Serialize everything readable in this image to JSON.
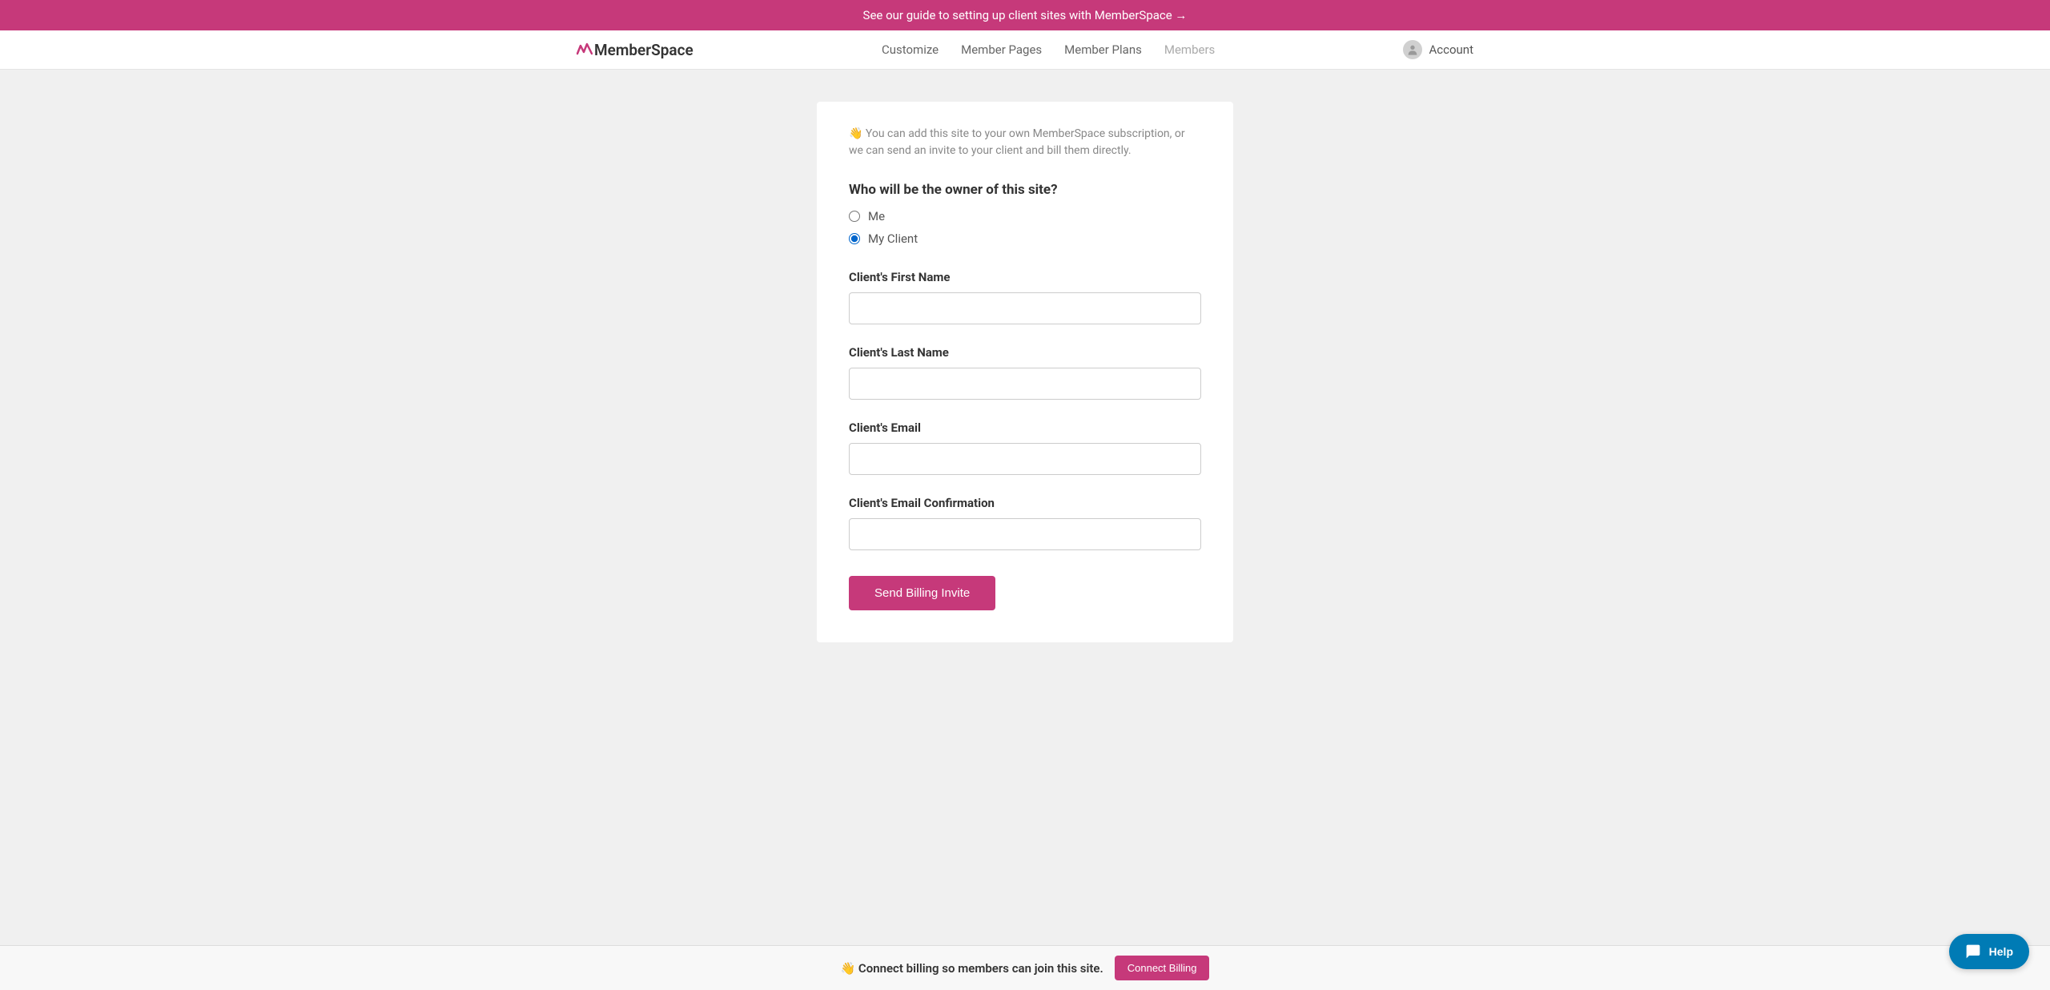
{
  "banner": {
    "text": "See our guide to setting up client sites with MemberSpace →"
  },
  "header": {
    "logo_text": "MemberSpace",
    "nav": {
      "customize": "Customize",
      "member_pages": "Member Pages",
      "member_plans": "Member Plans",
      "members": "Members"
    },
    "account_label": "Account"
  },
  "form": {
    "intro": "👋 You can add this site to your own MemberSpace subscription, or we can send an invite to your client and bill them directly.",
    "question": "Who will be the owner of this site?",
    "radio_me": "Me",
    "radio_client": "My Client",
    "first_name_label": "Client's First Name",
    "first_name_value": "",
    "last_name_label": "Client's Last Name",
    "last_name_value": "",
    "email_label": "Client's Email",
    "email_value": "",
    "email_confirm_label": "Client's Email Confirmation",
    "email_confirm_value": "",
    "submit_label": "Send Billing Invite"
  },
  "footer": {
    "billing_text": "👋 Connect billing so members can join this site.",
    "connect_button": "Connect Billing"
  },
  "help": {
    "label": "Help"
  }
}
